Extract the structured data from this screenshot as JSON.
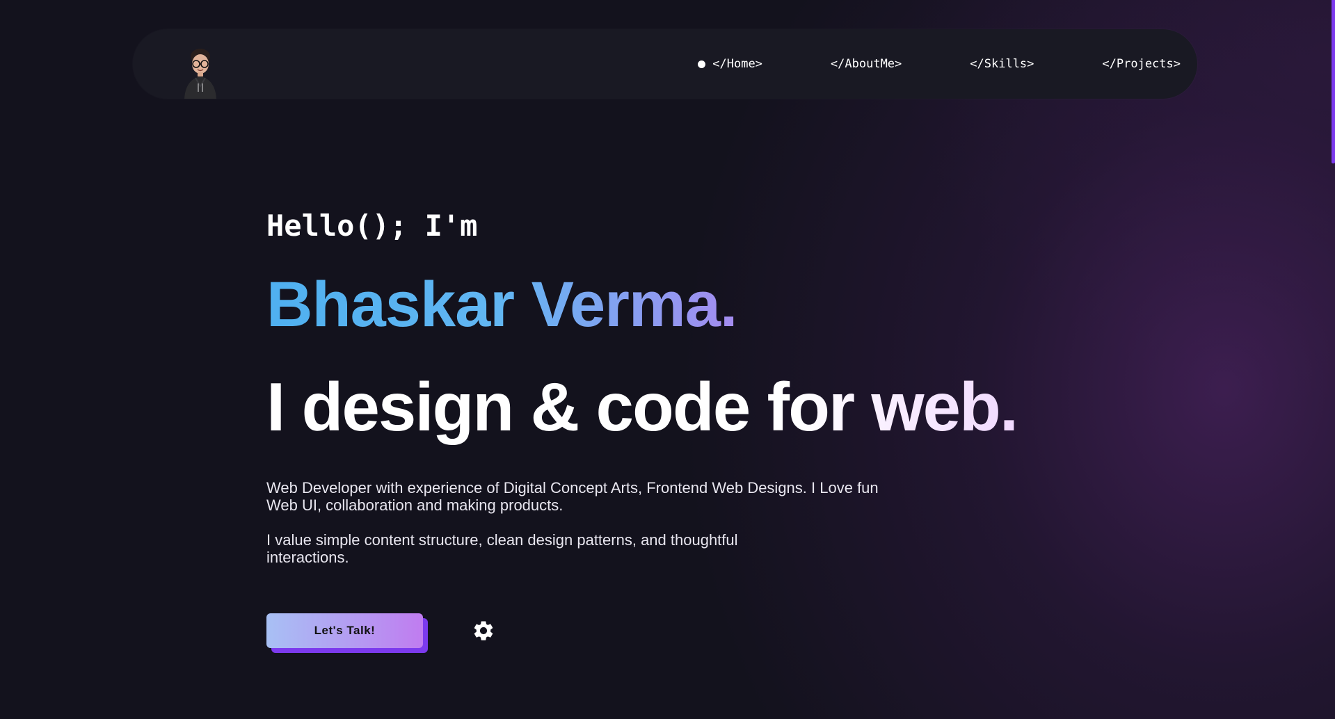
{
  "nav": {
    "items": [
      {
        "label": "</Home>",
        "active": true
      },
      {
        "label": "</AboutMe>",
        "active": false
      },
      {
        "label": "</Skills>",
        "active": false
      },
      {
        "label": "</Projects>",
        "active": false
      }
    ]
  },
  "hero": {
    "greeting": "Hello(); I'm",
    "name": "Bhaskar Verma.",
    "tagline": "I design & code for web.",
    "description_1": "Web Developer with experience of Digital Concept Arts, Frontend Web Designs. I Love fun Web UI, collaboration and making products.",
    "description_2": "I value simple content structure, clean design patterns, and thoughtful interactions.",
    "cta_label": "Let's Talk!"
  },
  "icons": {
    "avatar": "avatar-icon",
    "settings": "gear-icon"
  },
  "colors": {
    "background": "#13121d",
    "navbar": "#191923",
    "accent_purple": "#7c3aed",
    "name_gradient_start": "#4fb0f0",
    "name_gradient_end": "#a58cf0"
  }
}
